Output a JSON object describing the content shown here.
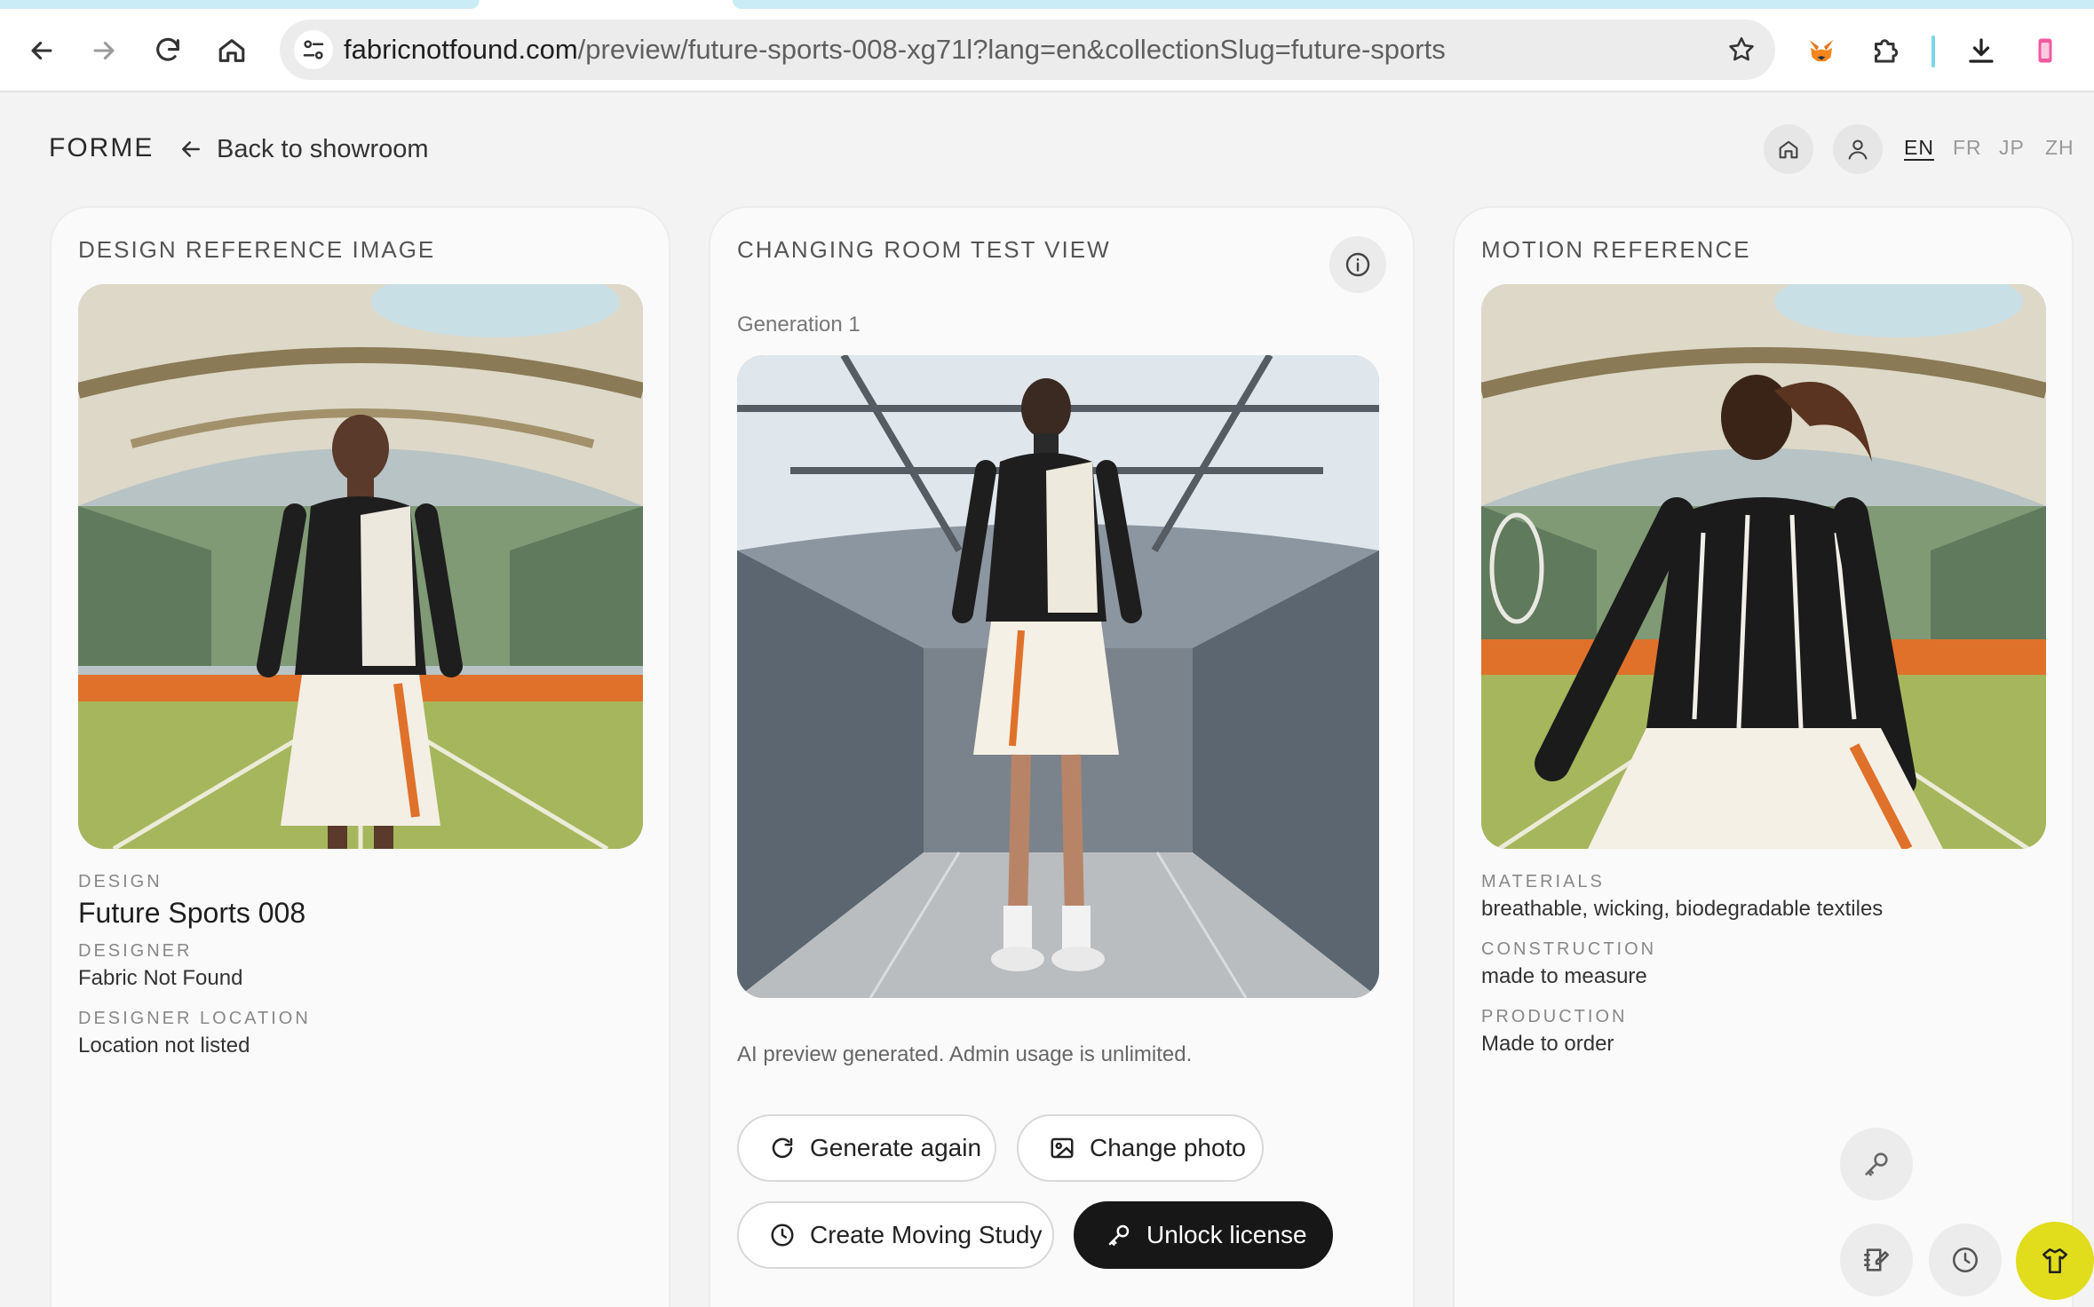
{
  "browser": {
    "url_host": "fabricnotfound.com",
    "url_path": "/preview/future-sports-008-xg71l?lang=en&collectionSlug=future-sports"
  },
  "header": {
    "brand": "FORME",
    "back_label": "Back to showroom",
    "languages": [
      "EN",
      "FR",
      "JP",
      "ZH"
    ],
    "active_language": "EN"
  },
  "design_panel": {
    "title": "DESIGN REFERENCE IMAGE",
    "fields": [
      {
        "label": "DESIGN",
        "value": "Future Sports 008"
      },
      {
        "label": "DESIGNER",
        "value": "Fabric Not Found"
      },
      {
        "label": "DESIGNER LOCATION",
        "value": "Location not listed"
      }
    ]
  },
  "changing_room": {
    "title": "CHANGING ROOM TEST VIEW",
    "generation_label": "Generation 1",
    "status": "AI preview generated. Admin usage is unlimited.",
    "buttons": {
      "generate_again": "Generate again",
      "change_photo": "Change photo",
      "create_moving_study": "Create Moving Study",
      "unlock_license": "Unlock license"
    }
  },
  "motion_panel": {
    "title": "MOTION REFERENCE",
    "fields": [
      {
        "label": "MATERIALS",
        "value": "breathable, wicking, biodegradable textiles"
      },
      {
        "label": "CONSTRUCTION",
        "value": "made to measure"
      },
      {
        "label": "PRODUCTION",
        "value": "Made to order"
      }
    ]
  },
  "colors": {
    "accent_fab": "#e1dc1c",
    "dark_button": "#171717",
    "court_orange": "#e0712b",
    "court_green": "#9aae55"
  }
}
